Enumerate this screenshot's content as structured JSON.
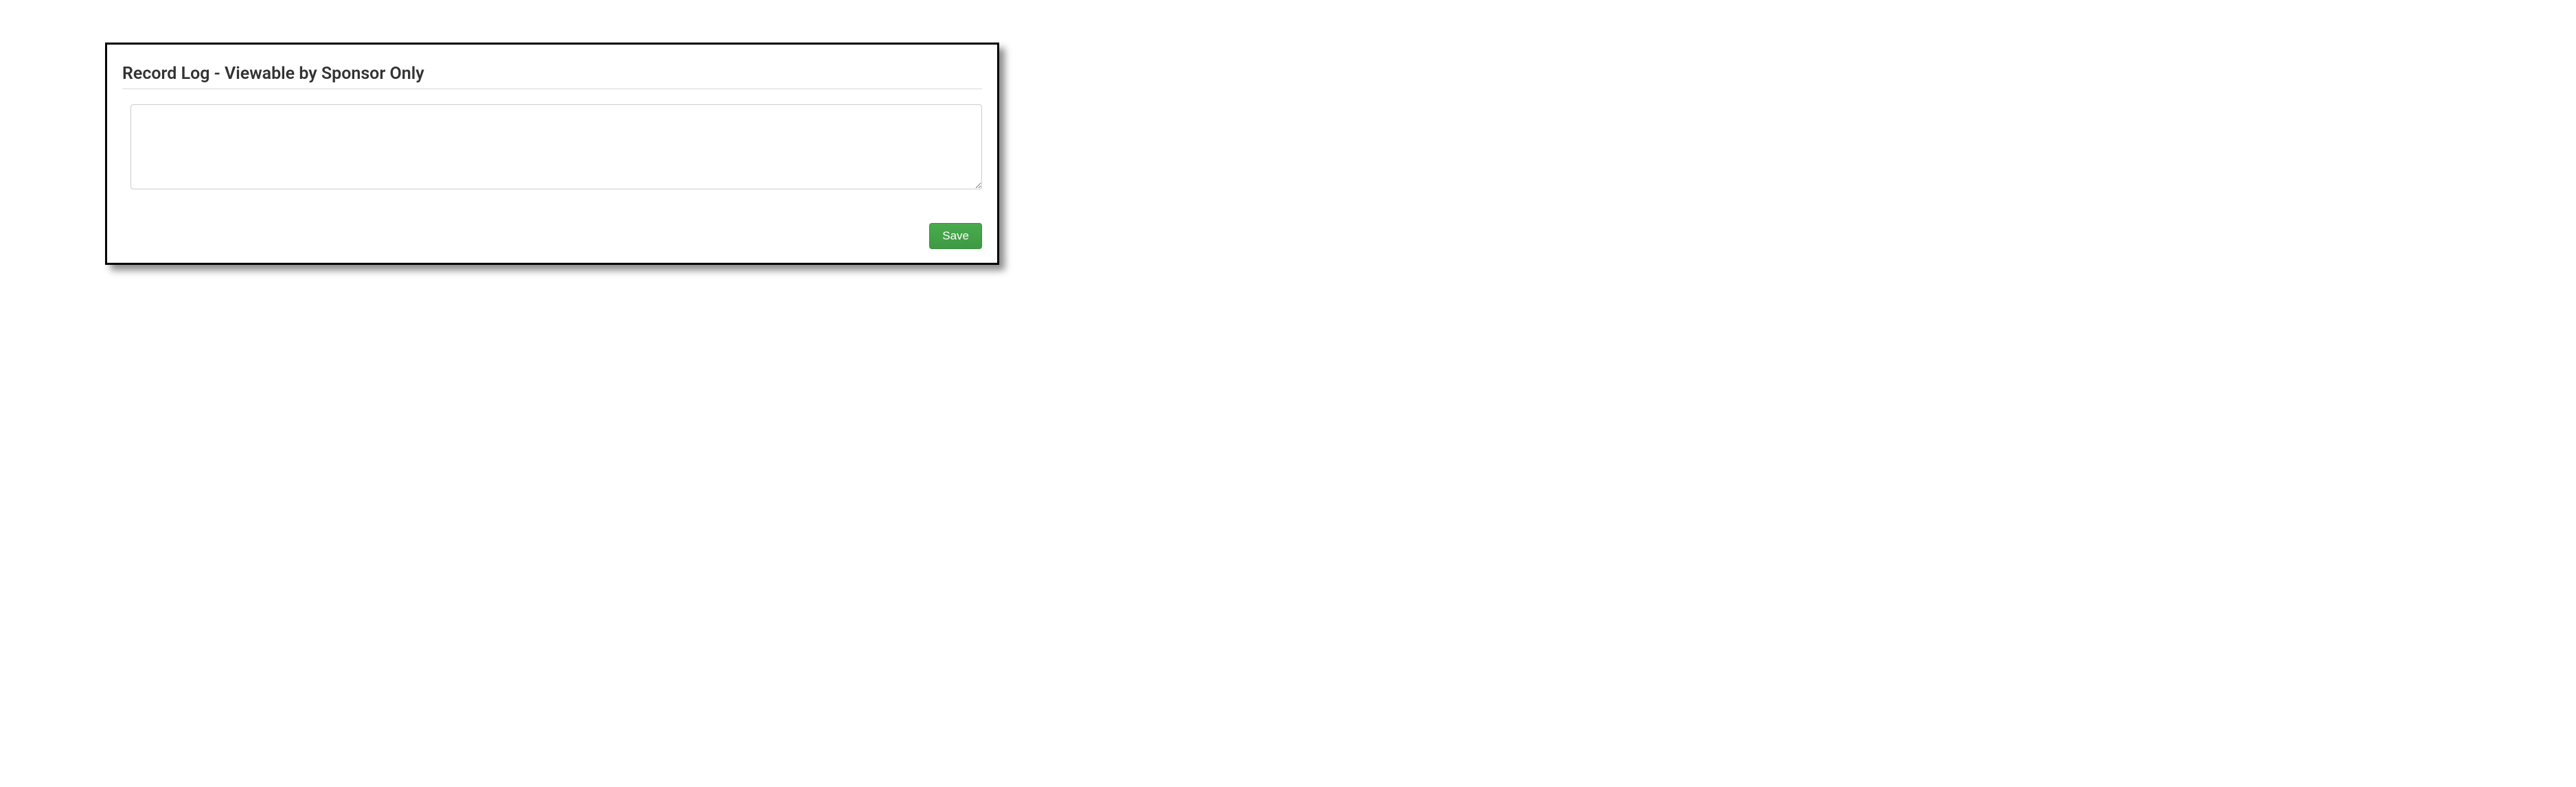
{
  "panel": {
    "title": "Record Log - Viewable by Sponsor Only",
    "log_value": "",
    "log_placeholder": ""
  },
  "actions": {
    "save_label": "Save"
  },
  "colors": {
    "accent_green": "#43a047",
    "border": "#000000"
  }
}
